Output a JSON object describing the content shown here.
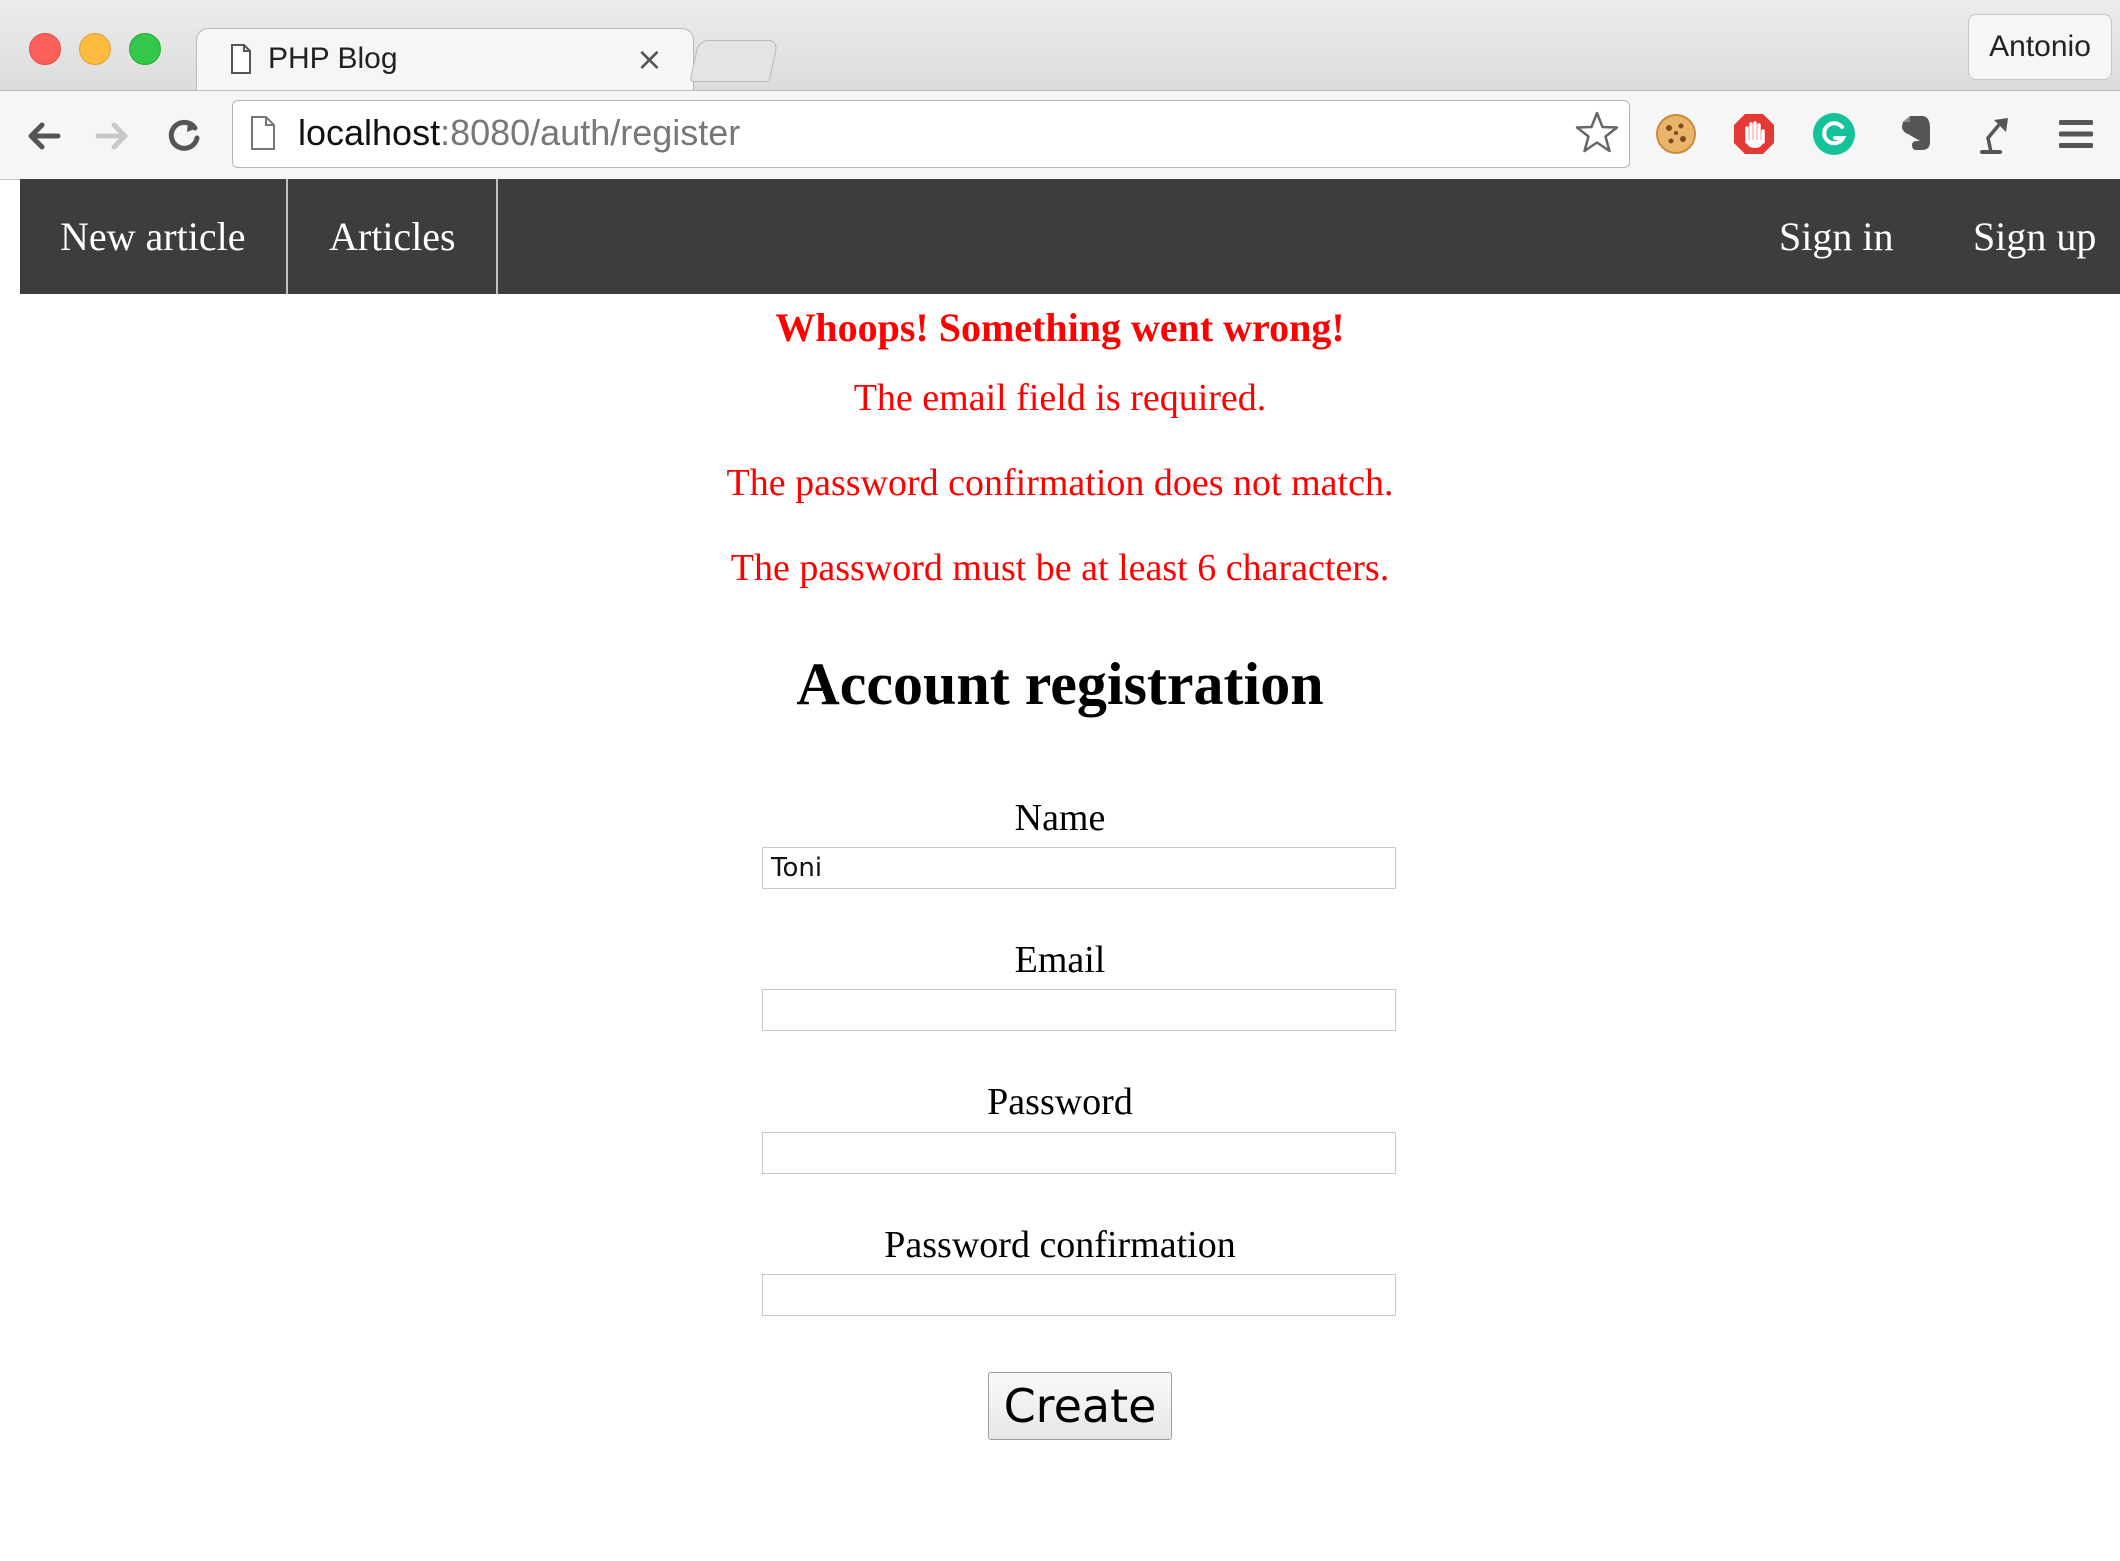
{
  "browser": {
    "tab": {
      "title": "PHP Blog",
      "close_glyph": "×"
    },
    "profile_name": "Antonio",
    "address": {
      "host": "localhost",
      "rest": ":8080/auth/register"
    },
    "nav_icons": [
      "back-arrow-icon",
      "forward-arrow-icon",
      "reload-icon"
    ],
    "extension_icons": [
      "cookie-icon",
      "adblock-hand-icon",
      "grammarly-icon",
      "evernote-icon",
      "lamp-icon",
      "menu-icon"
    ]
  },
  "site_nav": {
    "left": [
      "New article",
      "Articles"
    ],
    "right": [
      "Sign in",
      "Sign up"
    ]
  },
  "errors": {
    "heading": "Whoops! Something went wrong!",
    "messages": [
      "The email field is required.",
      "The password confirmation does not match.",
      "The password must be at least 6 characters."
    ]
  },
  "form": {
    "title": "Account registration",
    "fields": [
      {
        "label": "Name",
        "value": "Toni"
      },
      {
        "label": "Email",
        "value": ""
      },
      {
        "label": "Password",
        "value": ""
      },
      {
        "label": "Password confirmation",
        "value": ""
      }
    ],
    "submit_label": "Create"
  },
  "colors": {
    "nav_background": "#3d3d3d",
    "error_text": "#ff0000"
  }
}
